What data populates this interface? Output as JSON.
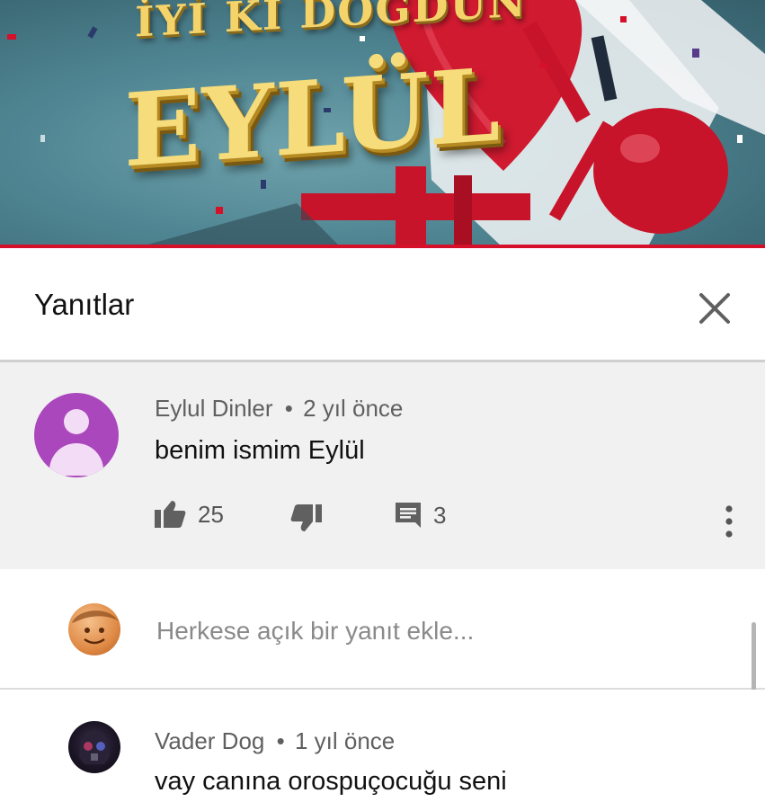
{
  "video": {
    "banner_top": "İYİ Kİ DOĞDUN",
    "banner_name": "EYLÜL",
    "accent_color": "#d6102a"
  },
  "replies_panel": {
    "title": "Yanıtlar",
    "close_icon": "close-icon"
  },
  "parent_comment": {
    "author": "Eylul Dinler",
    "separator": "•",
    "time": "2 yıl önce",
    "text": "benim ismim Eylül",
    "avatar_color": "#ab47bc",
    "likes": "25",
    "replies": "3",
    "icons": {
      "like": "thumbs-up-icon",
      "dislike": "thumbs-down-icon",
      "reply": "comment-icon",
      "more": "more-vertical-icon"
    }
  },
  "reply_box": {
    "placeholder": "Herkese açık bir yanıt ekle..."
  },
  "replies": [
    {
      "author": "Vader Dog",
      "separator": "•",
      "time": "1 yıl önce",
      "text": "vay canına orospuçocuğu seni"
    }
  ]
}
